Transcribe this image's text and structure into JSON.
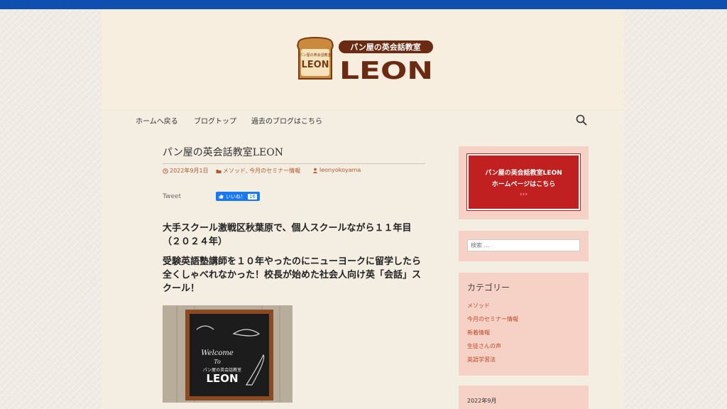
{
  "logo": {
    "badge_top": "パン屋の英会話教室",
    "badge_main": "LEON",
    "title_jp": "パン屋の英会話教室",
    "title_en": "LEON"
  },
  "nav": {
    "items": [
      {
        "label": "ホームへ戻る"
      },
      {
        "label": "ブログトップ"
      },
      {
        "label": "過去のブログはこちら"
      }
    ]
  },
  "post": {
    "title": "パン屋の英会話教室LEON",
    "date": "2022年9月1日",
    "categories": "メソッド, 今月のセミナー情報",
    "author": "leonyokoyama",
    "tweet": "Tweet",
    "like_label": "いいね！",
    "like_count": "16",
    "para1": "大手スクール激戦区秋葉原で、個人スクールながら１１年目（２０２４年）",
    "para2": "受験英語塾講師を１０年やったのにニューヨークに留学したら全くしゃべれなかった！校長が始めた社会人向け英「会話」スクール！",
    "photo": {
      "welcome": "Welcome",
      "to": "To",
      "sign_small": "パン屋の英会話教室",
      "sign_main": "LEON"
    }
  },
  "sidebar": {
    "banner_line1": "パン屋の英会話教室LEON",
    "banner_line2": "ホームページはこちら",
    "banner_arrows": "›››",
    "search_placeholder": "検索 …",
    "categories_title": "カテゴリー",
    "categories": [
      {
        "label": "メソッド"
      },
      {
        "label": "今月のセミナー情報"
      },
      {
        "label": "新着情報"
      },
      {
        "label": "生徒さんの声"
      },
      {
        "label": "英語学習法"
      }
    ],
    "archive_item": "2022年9月"
  },
  "colors": {
    "topbar": "#0f4fb0",
    "brand_brown": "#6b2a12",
    "link": "#c04a28",
    "widget_bg": "#f5d1c6",
    "banner_red": "#c0201f"
  }
}
